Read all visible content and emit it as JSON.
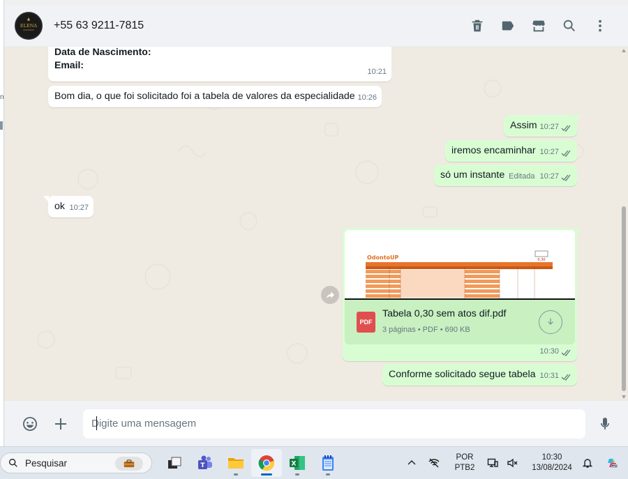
{
  "header": {
    "contact_name": "+55 63 9211-7815",
    "avatar_text": "ELENA",
    "icons": [
      "trash-icon",
      "label-icon",
      "store-icon",
      "search-icon",
      "more-icon"
    ]
  },
  "messages": {
    "m1": {
      "lines": [
        "Data de Nascimento:",
        "Email:"
      ],
      "time": "10:21"
    },
    "m2": {
      "text": "Bom dia, o que foi solicitado foi a tabela de valores da especialidade",
      "time": "10:26"
    },
    "m3": {
      "text": "Assim",
      "time": "10:27"
    },
    "m4": {
      "text": "iremos encaminhar",
      "time": "10:27"
    },
    "m5": {
      "text": "só um instante",
      "edited": "Editada",
      "time": "10:27"
    },
    "m6": {
      "text": "ok",
      "time": "10:27"
    },
    "m7": {
      "file_name": "Tabela 0,30 sem atos dif.pdf",
      "file_meta": "3 páginas • PDF • 690 KB",
      "pdf_label": "PDF",
      "time": "10:30",
      "preview_logo": "OdontoUP",
      "preview_value": "0,30"
    },
    "m8": {
      "text": "Conforme solicitado segue tabela",
      "time": "10:31"
    }
  },
  "composer": {
    "placeholder": "Digite uma mensagem"
  },
  "taskbar": {
    "search_label": "Pesquisar",
    "lang": "POR",
    "layout": "PTB2",
    "time": "10:30",
    "date": "13/08/2024"
  },
  "colors": {
    "outgoing": "#d9fdd3",
    "incoming": "#ffffff",
    "chat_bg": "#efeae2",
    "tick": "#667781"
  }
}
